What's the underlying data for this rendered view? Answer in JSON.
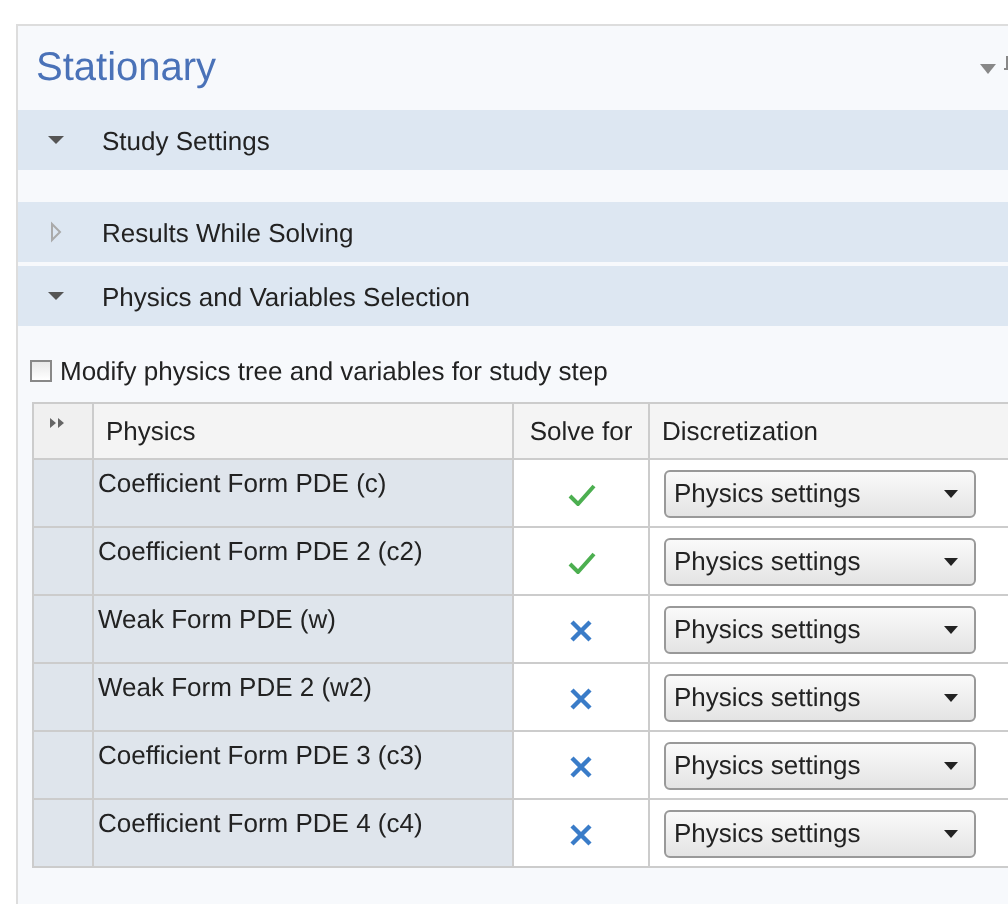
{
  "panel": {
    "title": "Stationary"
  },
  "sections": [
    {
      "label": "Study Settings",
      "expanded": true
    },
    {
      "label": "Results While Solving",
      "expanded": false
    },
    {
      "label": "Physics and Variables Selection",
      "expanded": true
    }
  ],
  "modify_checkbox": {
    "label": "Modify physics tree and variables for study step",
    "checked": false
  },
  "table": {
    "columns": [
      "Physics",
      "Solve for",
      "Discretization"
    ],
    "rows": [
      {
        "physics": "Coefficient Form PDE (c)",
        "solve_for": true,
        "discretization": "Physics settings"
      },
      {
        "physics": "Coefficient Form PDE 2 (c2)",
        "solve_for": true,
        "discretization": "Physics settings"
      },
      {
        "physics": "Weak Form PDE (w)",
        "solve_for": false,
        "discretization": "Physics settings"
      },
      {
        "physics": "Weak Form PDE 2 (w2)",
        "solve_for": false,
        "discretization": "Physics settings"
      },
      {
        "physics": "Coefficient Form PDE 3 (c3)",
        "solve_for": false,
        "discretization": "Physics settings"
      },
      {
        "physics": "Coefficient Form PDE 4 (c4)",
        "solve_for": false,
        "discretization": "Physics settings"
      }
    ]
  }
}
